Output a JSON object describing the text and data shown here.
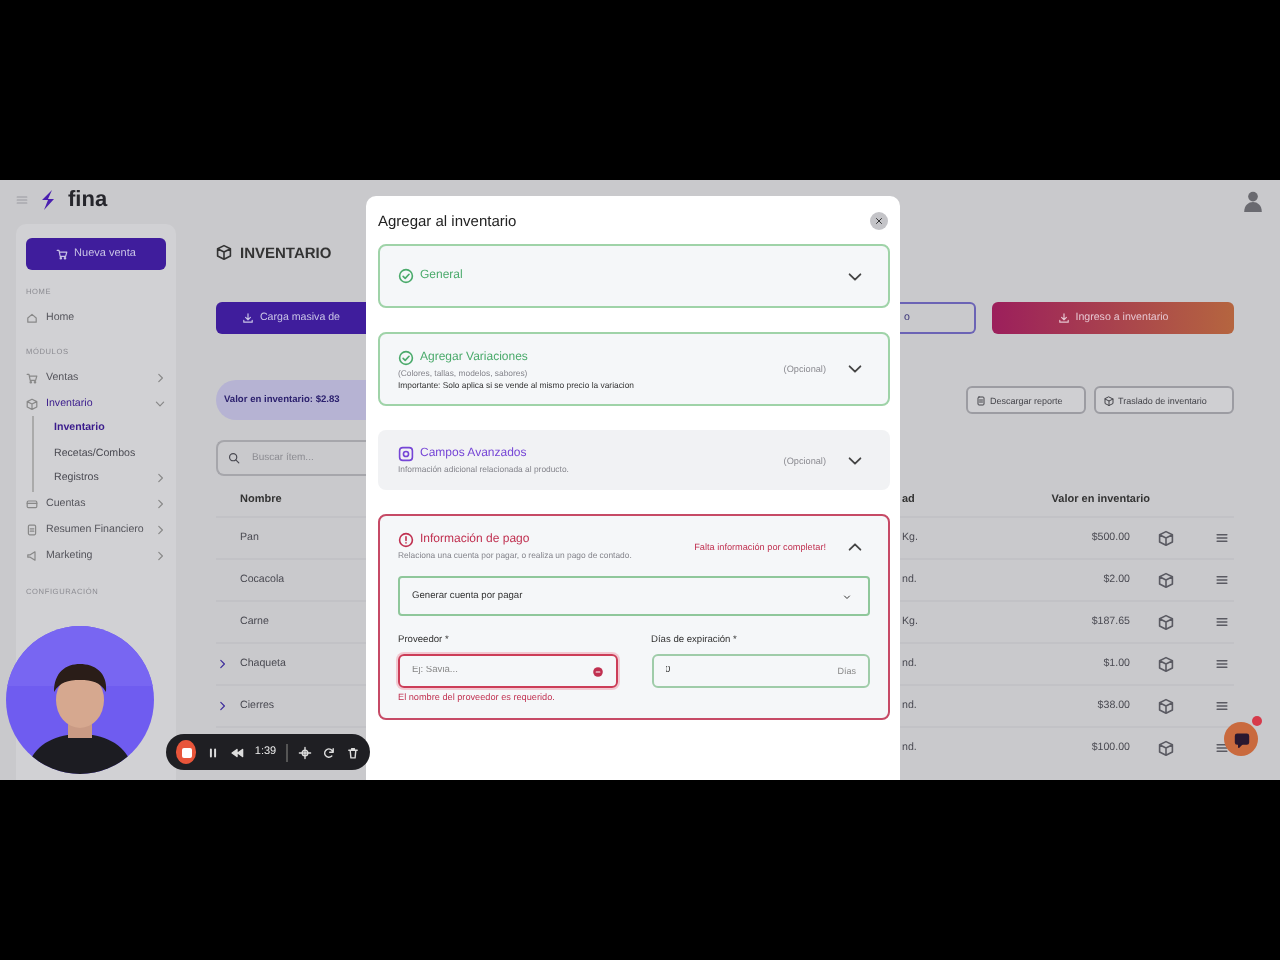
{
  "app_bar": {
    "logo": "fina"
  },
  "sidebar": {
    "new_sale_button": "Nueva venta",
    "sections": [
      {
        "heading": "HOME",
        "items": [
          {
            "label": "Home",
            "selected": false
          }
        ]
      },
      {
        "heading": "MÓDULOS",
        "items": [
          {
            "label": "Ventas",
            "selected": false,
            "expanded": false
          },
          {
            "label": "Inventario",
            "selected": true,
            "expanded": true,
            "children": [
              {
                "label": "Inventario",
                "selected": true
              },
              {
                "label": "Recetas/Combos",
                "selected": false
              },
              {
                "label": "Registros",
                "selected": false,
                "expanded": false
              }
            ]
          },
          {
            "label": "Cuentas",
            "selected": false,
            "expanded": false
          },
          {
            "label": "Resumen Financiero",
            "selected": false,
            "expanded": false
          },
          {
            "label": "Marketing",
            "selected": false,
            "expanded": false
          }
        ]
      },
      {
        "heading": "CONFIGURACIÓN"
      }
    ]
  },
  "page": {
    "title": "INVENTARIO",
    "bulk_upload_button": "Carga masiva de",
    "button_2": "o",
    "stock_in_button": "Ingreso a inventario",
    "inventory_value": "Valor en inventario: $2.83",
    "report_button": "Descargar reporte",
    "transfer_button": "Traslado de inventario",
    "search": {
      "placeholder": "Buscar ítem..."
    },
    "table": {
      "columns": [
        "Nombre",
        "ad",
        "Valor en inventario"
      ],
      "rows": [
        {
          "name": "Pan",
          "unit": "Kg.",
          "value": "$500.00",
          "expandable": false
        },
        {
          "name": "Cocacola",
          "unit": "nd.",
          "value": "$2.00",
          "expandable": false
        },
        {
          "name": "Carne",
          "unit": "Kg.",
          "value": "$187.65",
          "expandable": false
        },
        {
          "name": "Chaqueta",
          "unit": "nd.",
          "value": "$1.00",
          "expandable": true
        },
        {
          "name": "Cierres",
          "unit": "nd.",
          "value": "$38.00",
          "expandable": true
        },
        {
          "unit": "nd.",
          "value": "$100.00",
          "expandable": false
        }
      ]
    }
  },
  "modal": {
    "title": "Agregar al inventario",
    "sections": [
      {
        "kind": "done",
        "title": "General",
        "expanded": false
      },
      {
        "kind": "done",
        "title": "Agregar Variaciones",
        "subtitle": "(Colores, tallas, modelos, sabores)",
        "note": "Importante: Solo aplica si se vende al mismo precio la variacion",
        "tag": "(Opcional)",
        "expanded": false
      },
      {
        "kind": "advanced",
        "title": "Campos Avanzados",
        "subtitle": "Información adicional relacionada al producto.",
        "tag": "(Opcional)",
        "expanded": false
      },
      {
        "kind": "error",
        "title": "Información de pago",
        "subtitle": "Relaciona una cuenta por pagar, o realiza un pago de contado.",
        "tag": "Falta información por completar!",
        "expanded": true,
        "form": {
          "payment_select": "Generar cuenta por pagar",
          "supplier": {
            "label": "Proveedor *",
            "placeholder": "Ej: Savia...",
            "invalid": true,
            "error": "El nombre del proveedor es requerido."
          },
          "expiry": {
            "label": "Días de expiración *",
            "value": "0",
            "suffix": "Días"
          }
        }
      }
    ]
  },
  "recorder": {
    "time": "1:39"
  }
}
